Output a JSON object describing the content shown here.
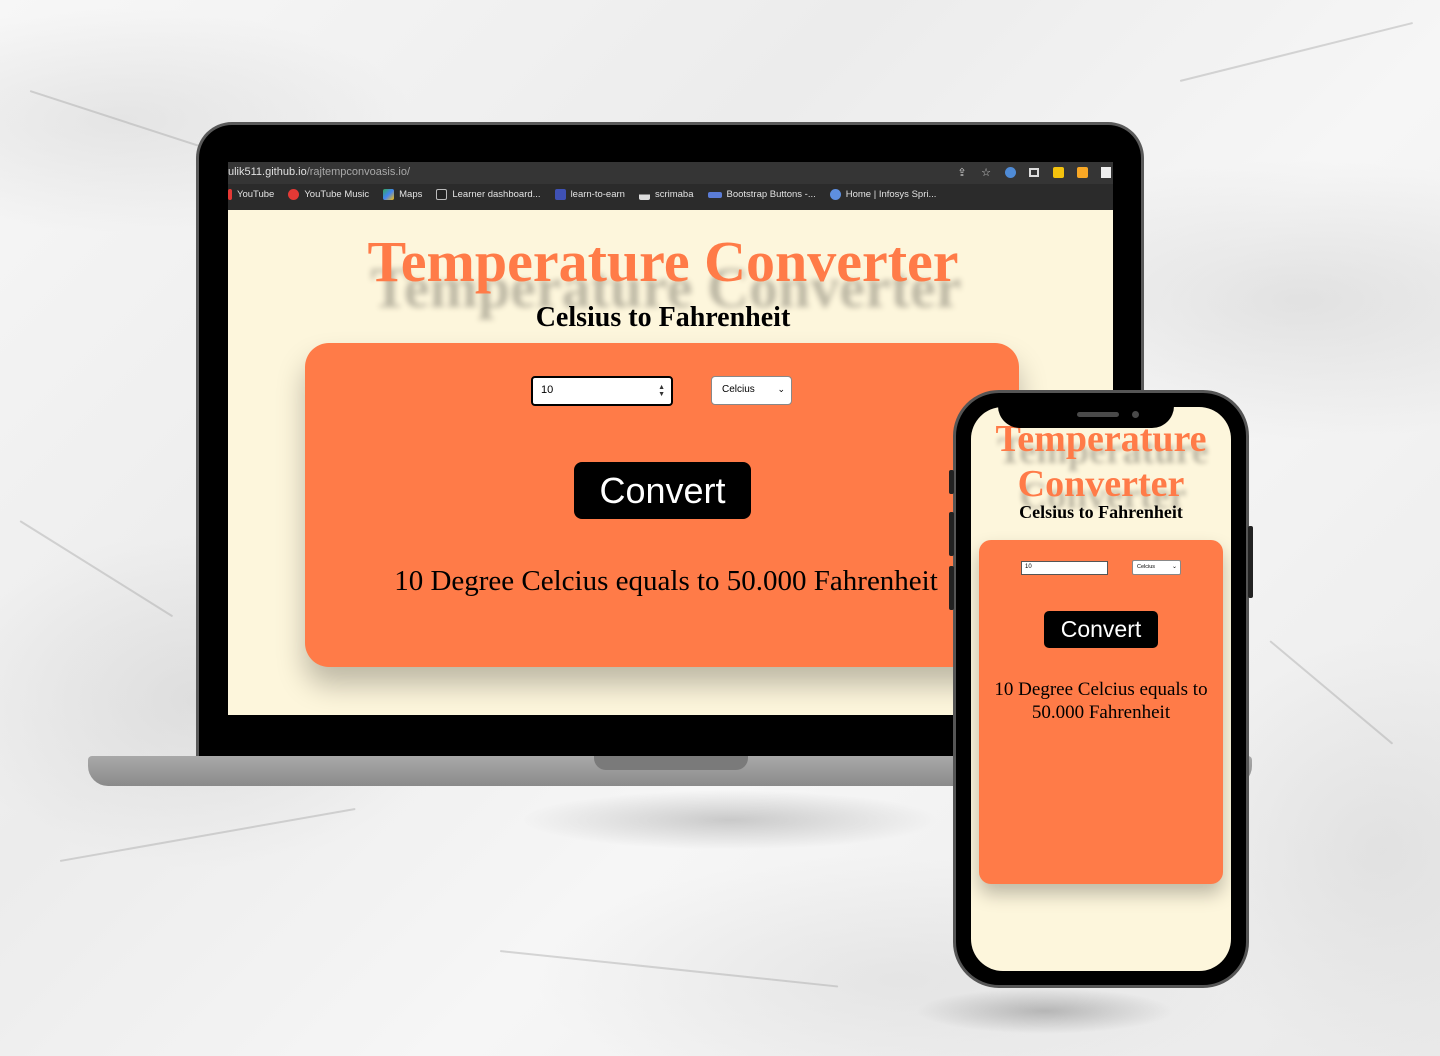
{
  "browser": {
    "url_host": "ulik511.github.io",
    "url_path": "/rajtempconvoasis.io/",
    "bookmarks": [
      "YouTube",
      "YouTube Music",
      "Maps",
      "Learner dashboard...",
      "learn-to-earn",
      "scrimaba",
      "Bootstrap Buttons -...",
      "Home | Infosys Spri..."
    ]
  },
  "app": {
    "title": "Temperature Converter",
    "title_line1": "Temperature",
    "title_line2": "Converter",
    "subtitle": "Celsius to Fahrenheit",
    "input_value": "10",
    "unit_selected": "Celcius",
    "button_label": "Convert",
    "result": "10 Degree Celcius equals to 50.000 Fahrenheit",
    "result_line1": "10 Degree Celcius equals to",
    "result_line2": "50.000 Fahrenheit"
  },
  "colors": {
    "accent": "#ff7b48",
    "page_bg": "#fdf6dc",
    "button": "#000000"
  }
}
